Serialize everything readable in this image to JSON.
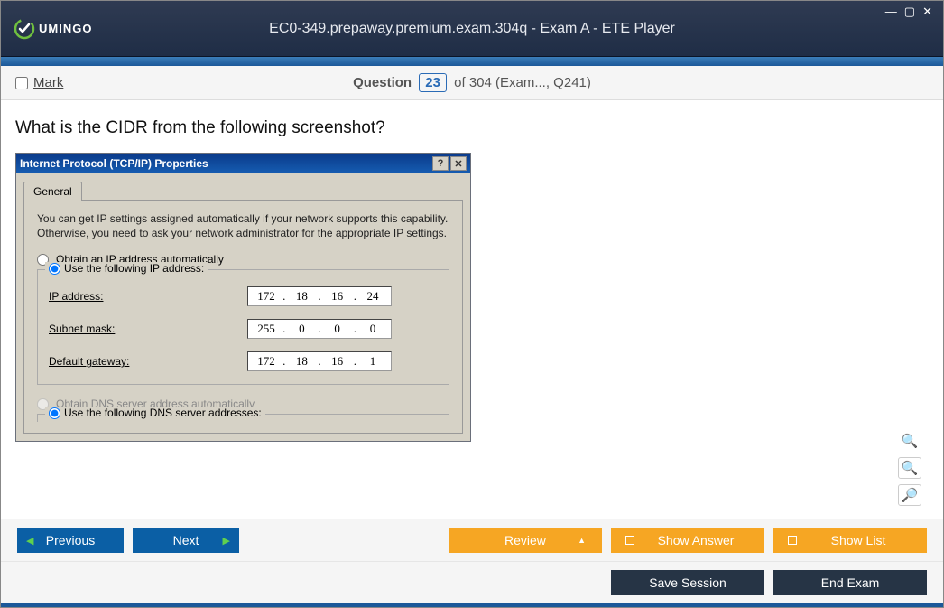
{
  "titlebar": {
    "logo_text": "UMINGO",
    "title": "EC0-349.prepaway.premium.exam.304q - Exam A - ETE Player"
  },
  "question_bar": {
    "mark_label": "Mark",
    "question_word": "Question",
    "number": "23",
    "suffix": "of 304 (Exam..., Q241)"
  },
  "question": {
    "text": "What is the CIDR from the following screenshot?"
  },
  "tcpip": {
    "title": "Internet Protocol (TCP/IP) Properties",
    "tab": "General",
    "desc": "You can get IP settings assigned automatically if your network supports this capability. Otherwise, you need to ask your network administrator for the appropriate IP settings.",
    "obtain_ip": "Obtain an IP address automatically",
    "use_ip": "Use the following IP address:",
    "ip_label": "IP address:",
    "subnet_label": "Subnet mask:",
    "gateway_label": "Default gateway:",
    "obtain_dns": "Obtain DNS server address automatically",
    "use_dns": "Use the following DNS server addresses:",
    "ip": [
      "172",
      "18",
      "16",
      "24"
    ],
    "subnet": [
      "255",
      "0",
      "0",
      "0"
    ],
    "gateway": [
      "172",
      "18",
      "16",
      "1"
    ]
  },
  "footer": {
    "previous": "Previous",
    "next": "Next",
    "review": "Review",
    "show_answer": "Show Answer",
    "show_list": "Show List",
    "save_session": "Save Session",
    "end_exam": "End Exam"
  }
}
